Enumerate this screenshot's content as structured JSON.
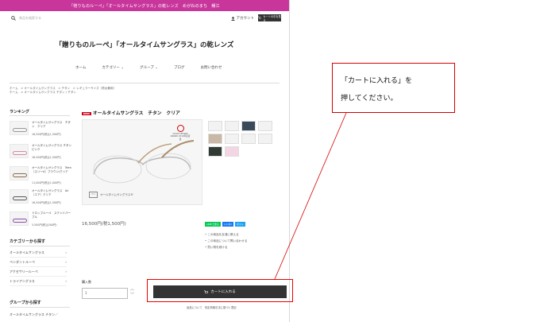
{
  "topbar": {
    "text": "「贈りものルーペ」「オールタイムサングラス」の乾レンズ　めがねのまち　鯖江"
  },
  "header": {
    "search_placeholder": "商品を検索する",
    "account_label": "アカウント",
    "cart_label": "カートの中を見る"
  },
  "site_title": "「贈りものルーペ」「オールタイムサングラス」の乾レンズ",
  "nav": [
    {
      "label": "ホーム"
    },
    {
      "label": "カテゴリー ⌄"
    },
    {
      "label": "グループ ⌄"
    },
    {
      "label": "ブログ"
    },
    {
      "label": "お問い合わせ"
    }
  ],
  "breadcrumb": {
    "line1": "ホーム　>  オールタイムサングラス　>  チタン　>  レギュラーサイズ（男女兼用）",
    "line2": "ホーム　>  オールタイムサングラス チタン / チタン"
  },
  "sidebar": {
    "ranking_title": "ランキング",
    "ranking": [
      {
        "name": "オールタイムサングラス　チタン　クリア",
        "price": "16,500円(税込1,500円)"
      },
      {
        "name": "オールタイムサングラス チタン　ピンク",
        "price": "16,500円(税込1,500円)"
      },
      {
        "name": "オールタイムサングラス　Teen（スリーA）ブラウン/クリア",
        "price": "11,000円(税込1,000円)"
      },
      {
        "name": "オールタイムサングラス　Air（エア）クリア",
        "price": "16,500円(税込1,500円)"
      },
      {
        "name": "ドロップルーペ　ステンドパープル",
        "price": "5,500円(税込500円)"
      }
    ],
    "category_title": "カテゴリーから探す",
    "categories": [
      {
        "label": "オールタイムサングラス"
      },
      {
        "label": "ペンダントルーペ"
      },
      {
        "label": "アクセサリールーペ"
      },
      {
        "label": "トライアングラス"
      }
    ],
    "group_title": "グループから探す",
    "groups": [
      {
        "label": "オールタイムサングラス チタン／"
      }
    ]
  },
  "product": {
    "badge": "NEW",
    "title": "オールタイムサングラス　チタン　クリア",
    "image_caption": "オールタイムサングラス®",
    "award": "GOOD DESIGN AWARD 2019年度受賞",
    "price": "16,500円(税1,500円)",
    "share": [
      {
        "label": "LINEで送る",
        "color": "#06c755"
      },
      {
        "label": "いいね!",
        "color": "#1877f2"
      },
      {
        "label": "ポスト",
        "color": "#1da1f2"
      }
    ],
    "links": [
      {
        "label": "この商品を友達に教える"
      },
      {
        "label": "この商品について問い合わせる"
      },
      {
        "label": "買い物を続ける"
      }
    ],
    "qty_label": "購入数",
    "qty_value": "1",
    "buy_label": "カートに入れる",
    "footnote": "返品について　特定商取引法に基づく表記"
  },
  "callout": {
    "line1": "「カートに入れる」を",
    "line2": "押してください。"
  },
  "colors": {
    "brand": "#c8369c",
    "highlight": "#e00000",
    "button": "#333333"
  }
}
